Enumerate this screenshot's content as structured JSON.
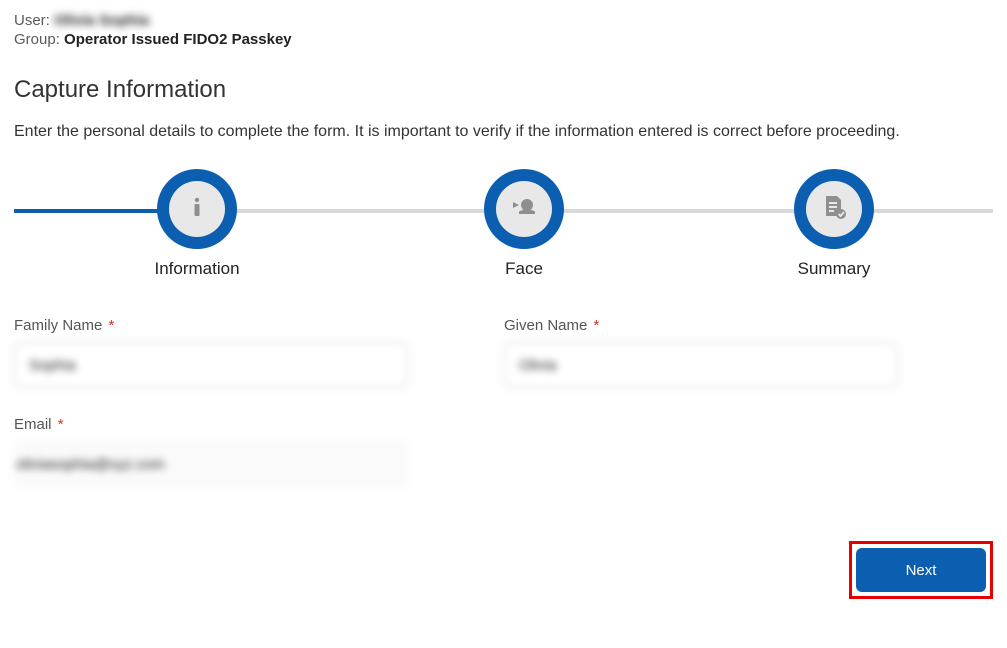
{
  "meta": {
    "user_label": "User:",
    "user_value": "Olivia Sophia",
    "group_label": "Group:",
    "group_value": "Operator Issued FIDO2 Passkey"
  },
  "page": {
    "title": "Capture Information",
    "instructions": "Enter the personal details to complete the form. It is important to verify if the information entered is correct before proceeding."
  },
  "stepper": {
    "steps": [
      {
        "label": "Information"
      },
      {
        "label": "Face"
      },
      {
        "label": "Summary"
      }
    ]
  },
  "form": {
    "family_name": {
      "label": "Family Name",
      "value": "Sophia"
    },
    "given_name": {
      "label": "Given Name",
      "value": "Olivia"
    },
    "email": {
      "label": "Email",
      "value": "oliviasophia@xyz.com"
    }
  },
  "actions": {
    "next_label": "Next"
  }
}
